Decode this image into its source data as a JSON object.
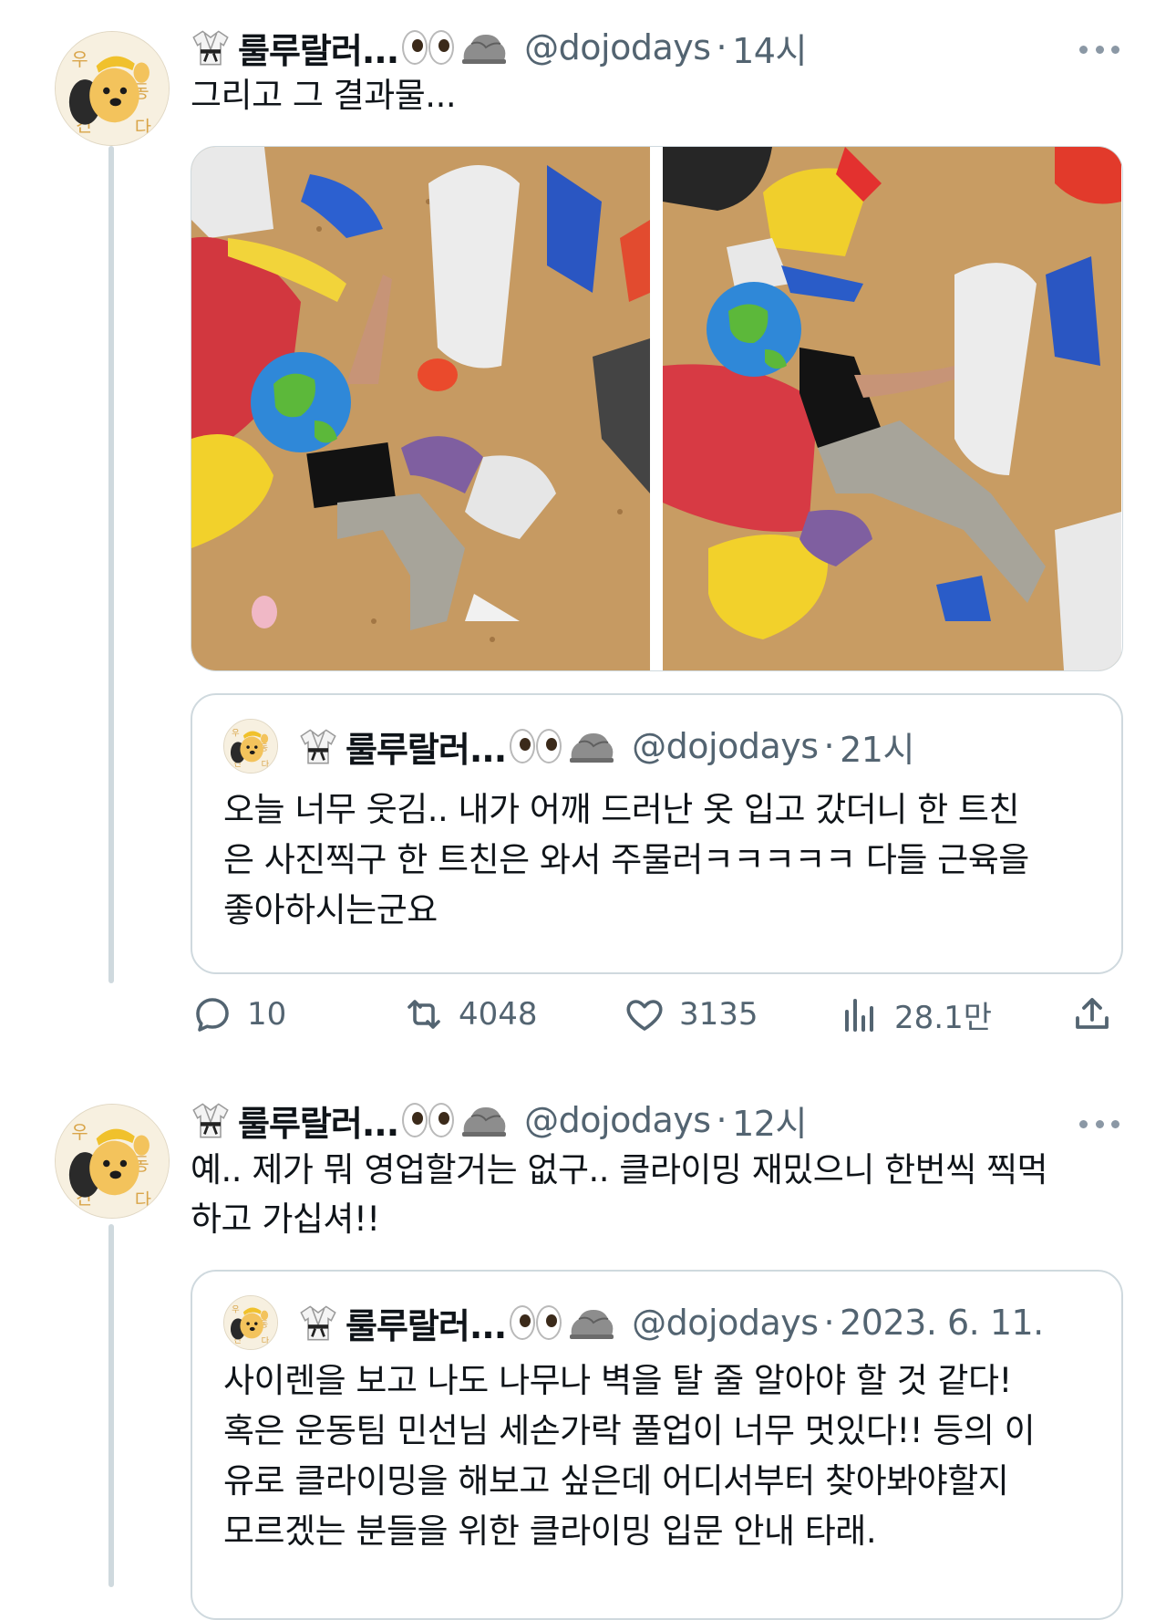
{
  "tweets": [
    {
      "display_name": "룰루랄러...",
      "handle": "@dojodays",
      "time": "14시",
      "text": "그리고 그 결과물...",
      "images": [
        {
          "alt": "climbing-photo-1"
        },
        {
          "alt": "climbing-photo-2"
        }
      ],
      "quote": {
        "display_name": "룰루랄러...",
        "handle": "@dojodays",
        "time": "21시",
        "text": "오늘 너무 웃김.. 내가 어깨 드러난 옷 입고 갔더니 한 트친\n은 사진찍구 한 트친은 와서 주물러ㅋㅋㅋㅋㅋ 다들 근육을\n좋아하시는군요"
      },
      "actions": {
        "reply_count": "10",
        "retweet_count": "4048",
        "like_count": "3135",
        "view_count": "28.1만"
      }
    },
    {
      "display_name": "룰루랄러...",
      "handle": "@dojodays",
      "time": "12시",
      "text": "예.. 제가 뭐 영업할거는 없구.. 클라이밍 재밌으니 한번씩 찍먹\n하고 가십셔!!",
      "quote": {
        "display_name": "룰루랄러...",
        "handle": "@dojodays",
        "time": "2023. 6. 11.",
        "text": "사이렌을 보고 나도 나무나 벽을 탈 줄 알아야 할 것 같다!\n혹은 운동팀 민선님 세손가락 풀업이 너무 멋있다!! 등의 이\n유로 클라이밍을 해보고 싶은데 어디서부터 찾아봐야할지\n모르겠는 분들을 위한 클라이밍 입문 안내 타래."
      }
    }
  ],
  "icons": [
    "karate-gi-icon",
    "eyes-icon",
    "rock-icon",
    "more-icon",
    "reply-icon",
    "retweet-icon",
    "like-icon",
    "views-icon",
    "share-icon"
  ],
  "colors": {
    "secondary_text": "#536471",
    "border": "#cfd9de",
    "thread_line": "#cfd9de"
  }
}
